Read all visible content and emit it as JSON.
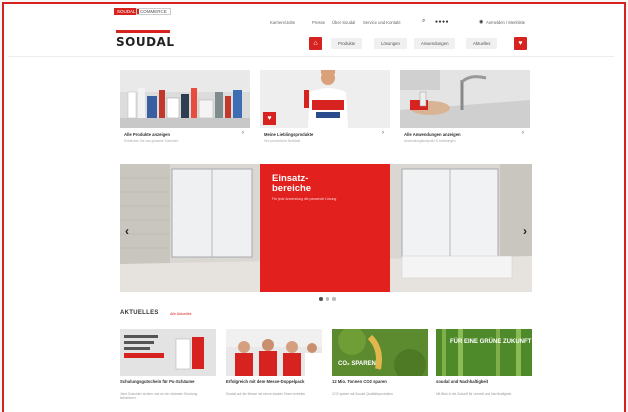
{
  "topbar": {
    "tab_active": "SOUDAL",
    "tab_inactive": "COMMERCE"
  },
  "utility_links": [
    "Karriere/Jobs",
    "Presse",
    "Über Soudal",
    "Service und Kontakt"
  ],
  "account": "Anmelden / Merkliste",
  "logo": "SOUDAL",
  "nav": {
    "items": [
      "Produkte",
      "Lösungen",
      "Anwendungen",
      "Aktuelles"
    ]
  },
  "tiles": [
    {
      "title": "Alle Produkte anzeigen",
      "sub": "Entdecken Sie das gesamte Sortiment"
    },
    {
      "title": "Meine Lieblingsprodukte",
      "sub": "Ihre persönliche Merkliste"
    },
    {
      "title": "Alle Anwendungen anzeigen",
      "sub": "Anwendungsbeispiele & Anleitungen"
    }
  ],
  "hero": {
    "title_line1": "Einsatz-",
    "title_line2": "bereiche",
    "sub": "Für jede Anwendung die passende Lösung"
  },
  "news": {
    "heading": "AKTUELLES",
    "link": "Alle Aktuelles",
    "cards": [
      {
        "title": "Schulungsgutschein für Pu-Schäume",
        "text": "Jetzt Gutschein sichern und an der nächsten Schulung teilnehmen.",
        "img_text": "SCHULUNG"
      },
      {
        "title": "Erfolgreich mit dem Messe-Doppelpack",
        "text": "Soudal auf der Messe mit einem starken Team vertreten.",
        "img_text": ""
      },
      {
        "title": "12 Mio. Tonnen CO2 sparen",
        "text": "CO2 sparen mit Soudal Qualitätsprodukten.",
        "img_text": "CO₂ SPAREN"
      },
      {
        "title": "soudal und Nachhaltigkeit",
        "text": "Mit Blick in die Zukunft für Umwelt und Nachhaltigkeit.",
        "img_text": "FÜR EINE GRÜNE ZUKUNFT"
      }
    ]
  },
  "colors": {
    "brand_red": "#d6231f",
    "hero_red": "#e2211f"
  }
}
